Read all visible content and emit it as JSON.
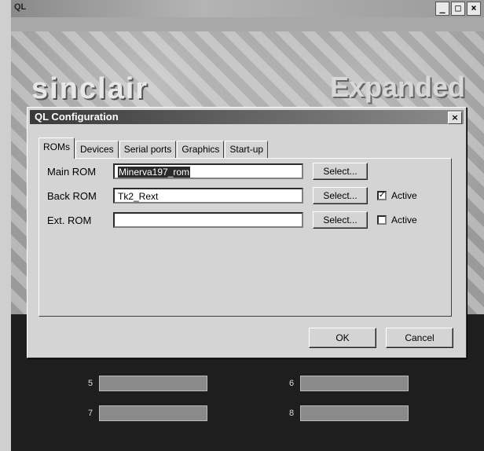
{
  "app": {
    "titlebar_icon": "QL",
    "window_controls": [
      "_",
      "□",
      "×"
    ],
    "brand_left": "sinclair",
    "brand_right": "Expanded QL",
    "drives": [
      {
        "number": "5"
      },
      {
        "number": "6"
      },
      {
        "number": "7"
      },
      {
        "number": "8"
      }
    ]
  },
  "dialog": {
    "title": "QL Configuration",
    "close_label": "×",
    "tabs": [
      {
        "label": "ROMs",
        "active": true
      },
      {
        "label": "Devices",
        "active": false
      },
      {
        "label": "Serial ports",
        "active": false
      },
      {
        "label": "Graphics",
        "active": false
      },
      {
        "label": "Start-up",
        "active": false
      }
    ],
    "rom_rows": [
      {
        "label": "Main ROM",
        "value": "Minerva197_rom",
        "select_label": "Select...",
        "has_active": false
      },
      {
        "label": "Back ROM",
        "value": "Tk2_Rext",
        "select_label": "Select...",
        "has_active": true,
        "active_label": "Active",
        "active_checked": true
      },
      {
        "label": "Ext. ROM",
        "value": "",
        "select_label": "Select...",
        "has_active": true,
        "active_label": "Active",
        "active_checked": false
      }
    ],
    "ok_label": "OK",
    "cancel_label": "Cancel"
  }
}
